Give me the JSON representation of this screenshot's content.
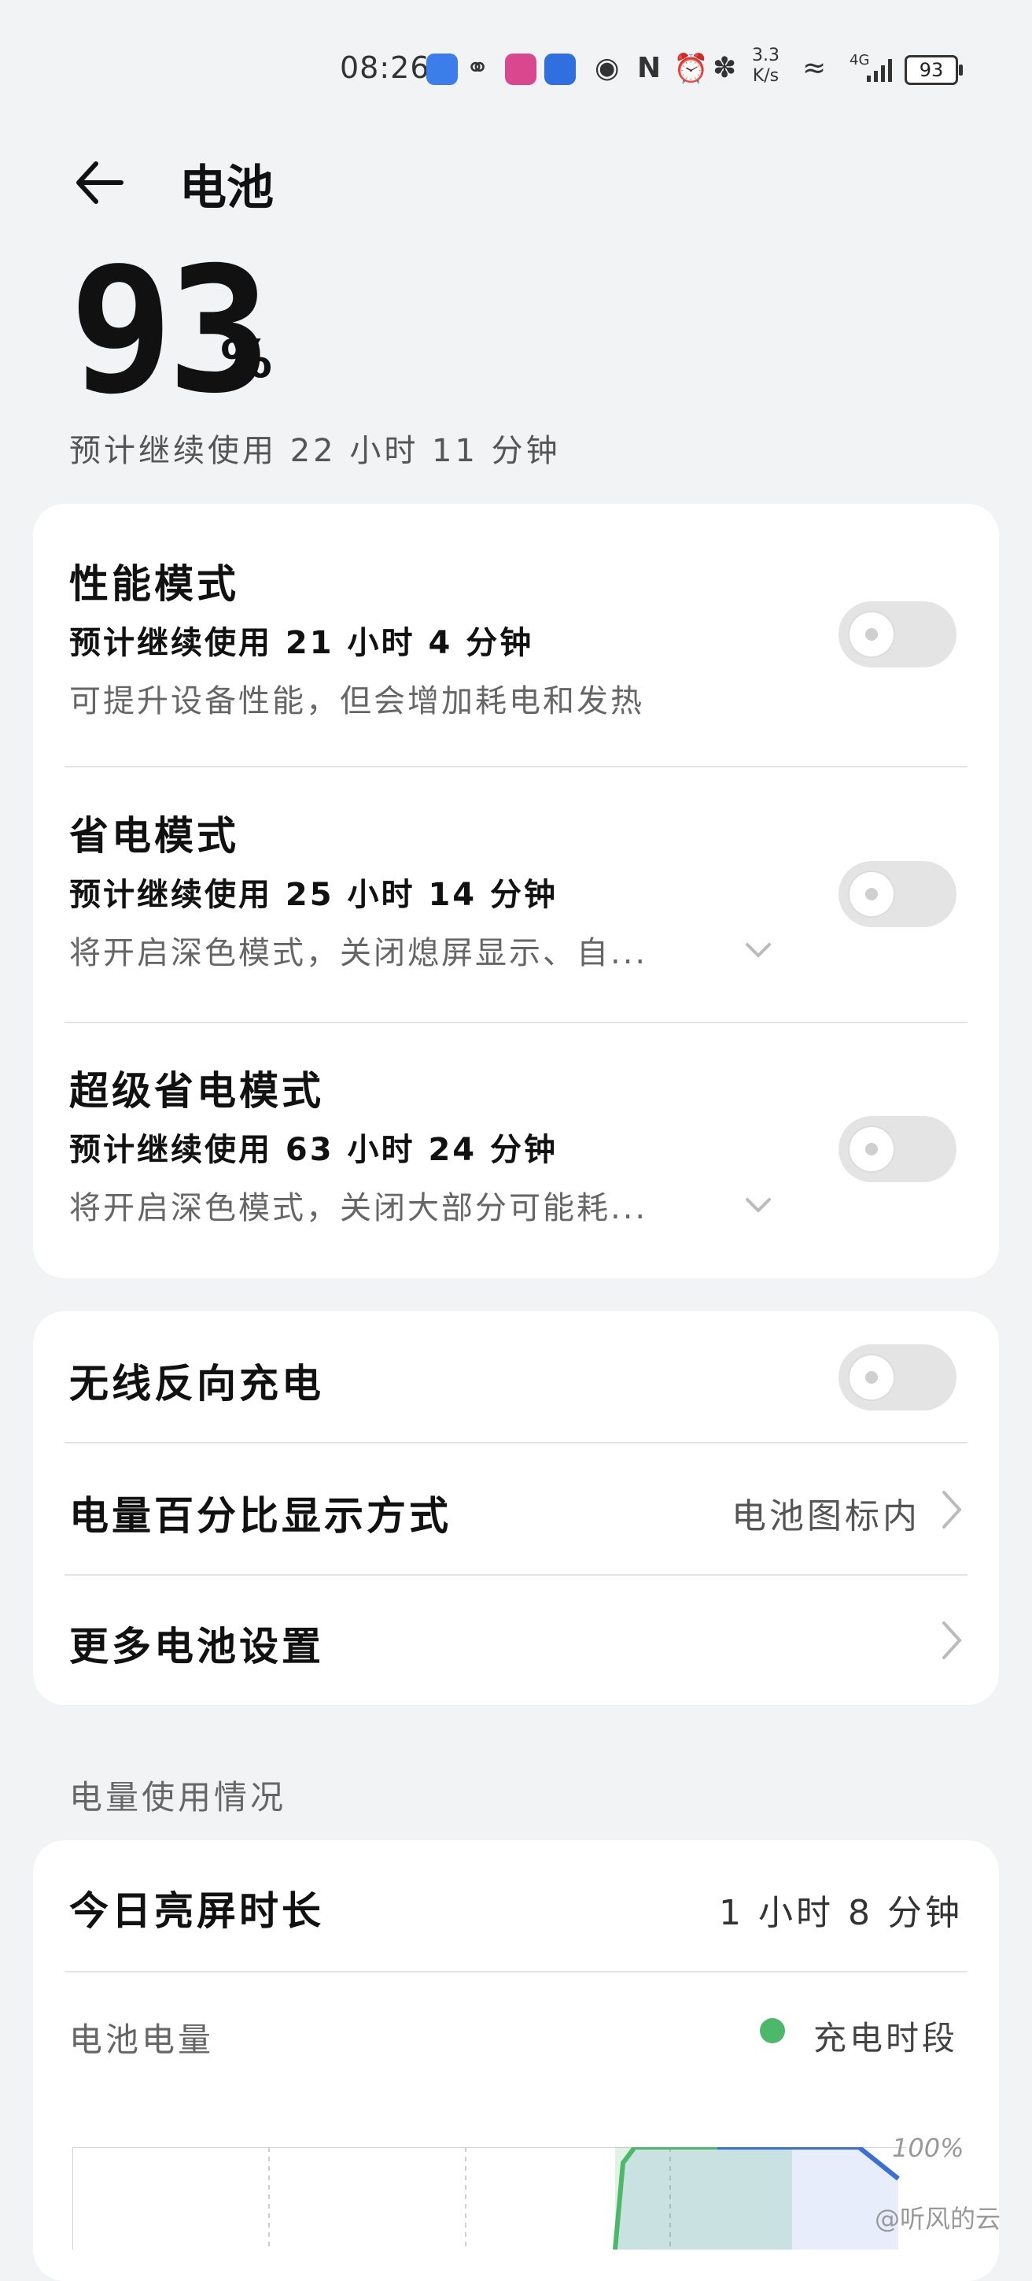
{
  "status_bar": {
    "time": "08:26",
    "network_speed": "3.3",
    "network_unit": "K/s",
    "network_type": "4G",
    "battery_level": "93",
    "icons": [
      "app-c-icon",
      "wechat-icon",
      "app-pink-icon",
      "alipay-icon",
      "eye-icon",
      "nfc-icon",
      "alarm-icon",
      "bluetooth-icon",
      "wifi-icon",
      "signal-icon",
      "battery-icon"
    ]
  },
  "header": {
    "title": "电池"
  },
  "battery": {
    "percent": "93",
    "percent_sign": "%",
    "estimate": "预计继续使用 22 小时 11 分钟"
  },
  "modes": [
    {
      "title": "性能模式",
      "estimate": "预计继续使用 21 小时 4 分钟",
      "desc": "可提升设备性能，但会增加耗电和发热",
      "enabled": false
    },
    {
      "title": "省电模式",
      "estimate": "预计继续使用 25 小时 14 分钟",
      "desc": "将开启深色模式，关闭熄屏显示、自...",
      "enabled": false
    },
    {
      "title": "超级省电模式",
      "estimate": "预计继续使用 63 小时 24 分钟",
      "desc": "将开启深色模式，关闭大部分可能耗...",
      "enabled": false
    }
  ],
  "settings": {
    "wireless_reverse": {
      "label": "无线反向充电",
      "enabled": false
    },
    "percent_display": {
      "label": "电量百分比显示方式",
      "value": "电池图标内"
    },
    "more": {
      "label": "更多电池设置"
    }
  },
  "usage": {
    "section_label": "电量使用情况",
    "screen_time_label": "今日亮屏时长",
    "screen_time_value": "1 小时 8 分钟",
    "battery_level_label": "电池电量",
    "legend_label": "充电时段",
    "axis_max": "100%"
  },
  "chart_data": {
    "type": "area",
    "y_max_label": "100%",
    "ylim": [
      0,
      100
    ],
    "charging_band_color": "#4cb86a",
    "line_color_before": "#4cb86a",
    "line_color_after": "#3a6fd8",
    "note_visible": "partial chart visible at bottom edge"
  },
  "watermark": "@听风的云",
  "colors": {
    "background": "#f1f3f5",
    "card": "#ffffff",
    "accent_green": "#4cb86a",
    "accent_blue": "#3a6fd8"
  }
}
